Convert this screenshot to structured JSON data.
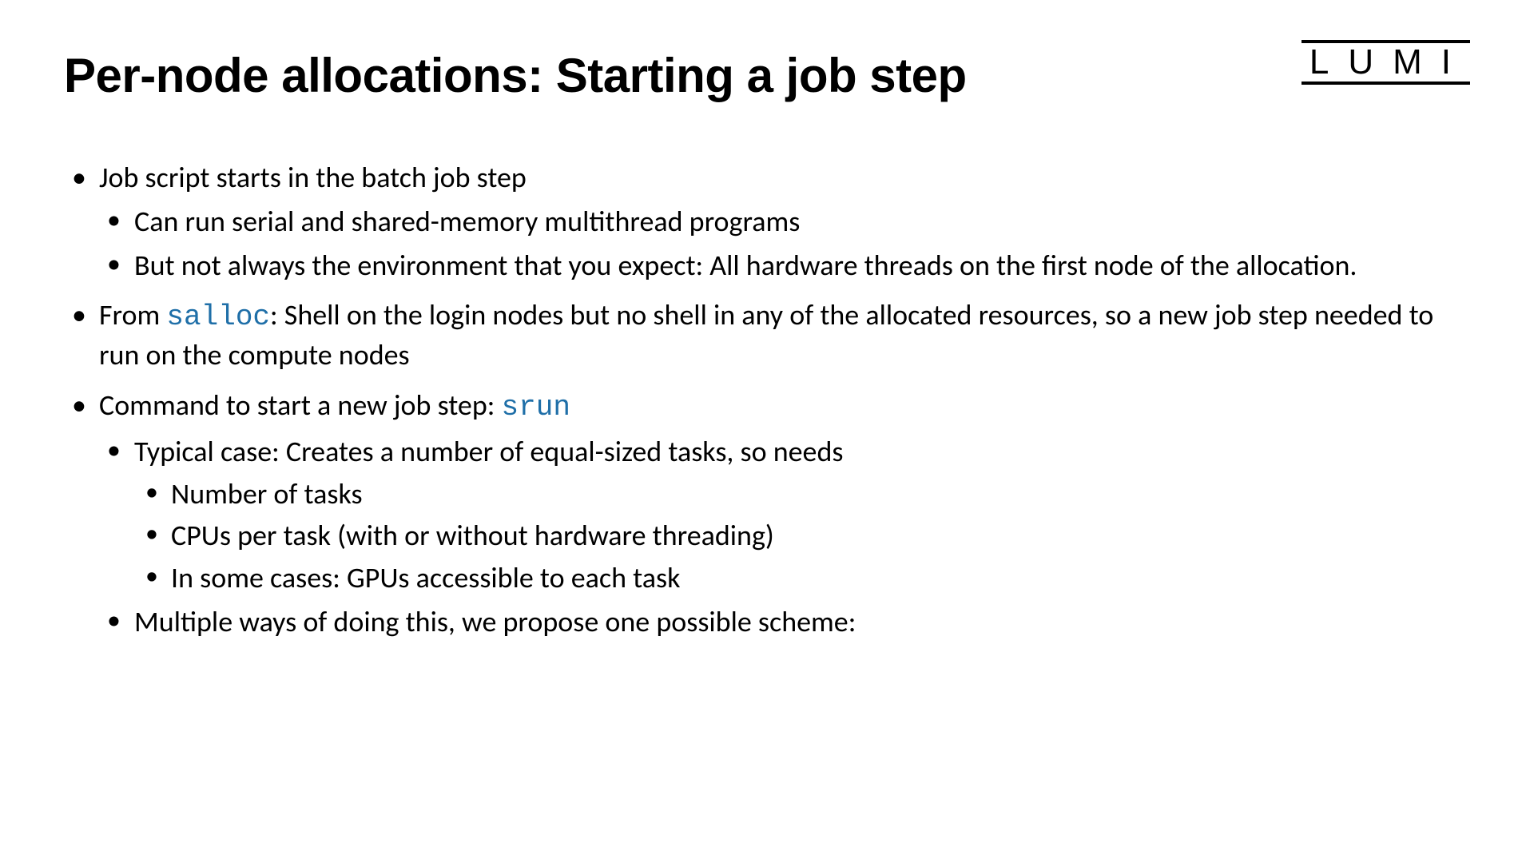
{
  "logo": "LUMI",
  "title": "Per-node allocations: Starting a job step",
  "bullets": {
    "b1": "Job script starts in the batch job step",
    "b1_1": "Can run serial and shared-memory multithread programs",
    "b1_2": "But not always the environment that you expect: All hardware threads on the first node of the allocation.",
    "b2_pre": "From ",
    "b2_code": "salloc",
    "b2_post": ": Shell on the login nodes but no shell in any of the allocated resources, so a new job step needed to run on the compute nodes",
    "b3_pre": "Command to start a new job step: ",
    "b3_code": "srun",
    "b3_1": "Typical case: Creates a number of equal-sized tasks, so needs",
    "b3_1_1": "Number of tasks",
    "b3_1_2": "CPUs per task (with or without hardware threading)",
    "b3_1_3": "In some cases: GPUs accessible to each task",
    "b3_2": "Multiple ways of doing this, we propose one possible scheme:"
  }
}
